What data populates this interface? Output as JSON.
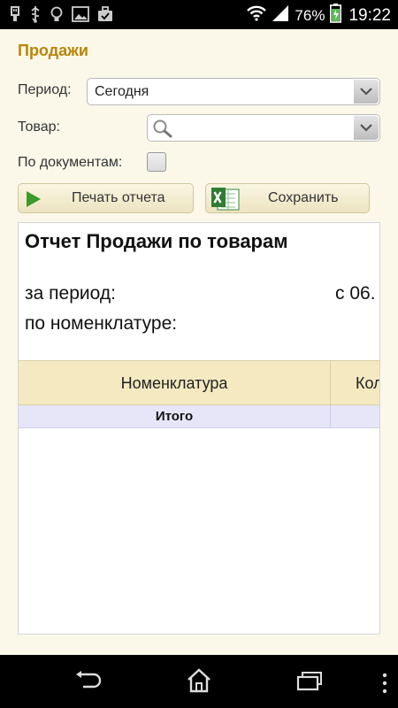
{
  "status_bar": {
    "battery_percent": "76%",
    "time": "19:22",
    "icons": [
      "usb-icon",
      "usb-debug-icon",
      "bulb-icon",
      "image-icon",
      "briefcase-icon",
      "wifi-icon",
      "signal-icon",
      "battery-charging-icon"
    ]
  },
  "app": {
    "title": "Продажи",
    "period": {
      "label": "Период:",
      "value": "Сегодня"
    },
    "product": {
      "label": "Товар:",
      "value": ""
    },
    "by_documents": {
      "label": "По документам:",
      "checked": false
    },
    "buttons": {
      "print": "Печать отчета",
      "save": "Сохранить"
    },
    "report": {
      "title": "Отчет Продажи по товарам",
      "period_label": "за период:",
      "period_value": "с 06.",
      "nomenclature_label": "по номенклатуре:",
      "columns": [
        "Номенклатура",
        "Кол"
      ],
      "total_label": "Итого"
    }
  },
  "colors": {
    "title": "#b8860b",
    "background": "#fbf8e9",
    "table_header": "#f4e9c0",
    "total_row": "#e6e6f8"
  }
}
